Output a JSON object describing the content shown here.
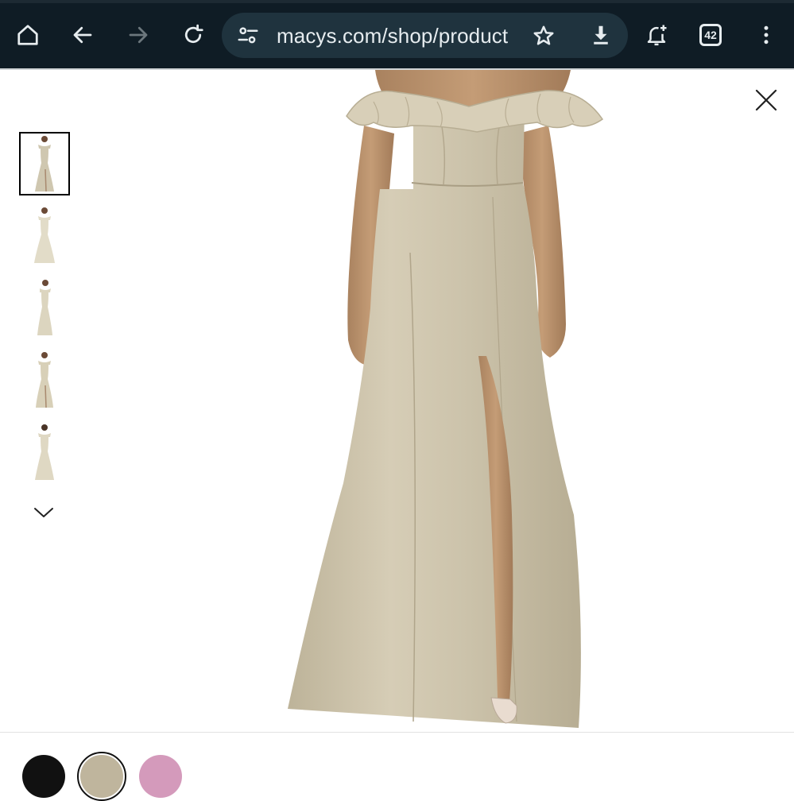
{
  "browser": {
    "url": "macys.com/shop/product",
    "tab_count": "42",
    "icons": [
      "home-icon",
      "back-icon",
      "forward-icon",
      "reload-icon",
      "site-settings-icon",
      "bookmark-star-icon",
      "download-icon",
      "notification-add-icon",
      "tab-count-icon",
      "overflow-menu-icon"
    ]
  },
  "viewer": {
    "selected_thumbnail_index": 0,
    "thumbnail_count_visible": 5,
    "icons": [
      "close-icon",
      "chevron-down-icon"
    ]
  },
  "swatches": {
    "colors": [
      "#111111",
      "#bfb59d",
      "#d49abb"
    ],
    "selected_index": 1
  },
  "colors": {
    "toolbar_bg": "#0f1c25",
    "omnibox_bg": "#1f333e",
    "dress": "#cec5ae"
  }
}
